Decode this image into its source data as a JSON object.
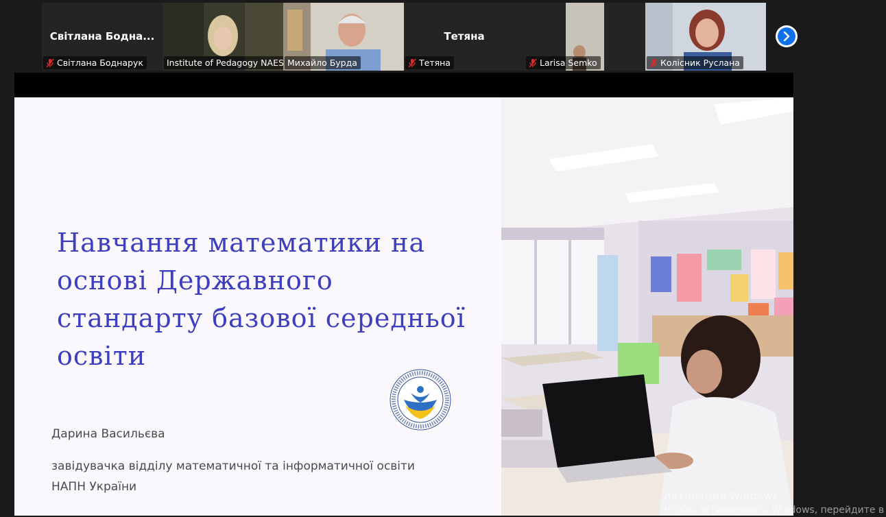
{
  "participants": [
    {
      "display": "Світлана  Бодна...",
      "label": "Світлана Боднарук",
      "muted": true,
      "video": false
    },
    {
      "display": "",
      "label": "Institute of Pedagogy NAES...",
      "muted": false,
      "video": true,
      "active": true
    },
    {
      "display": "",
      "label": "Михайло Бурда",
      "muted": false,
      "video": true
    },
    {
      "display": "Тетяна",
      "label": "Тетяна",
      "muted": true,
      "video": false
    },
    {
      "display": "",
      "label": "Larisa Semko",
      "muted": true,
      "video": true
    },
    {
      "display": "",
      "label": "Колісник Руслана",
      "muted": true,
      "video": true
    }
  ],
  "slide": {
    "title": "Навчання математики на основі Державного стандарту базової середньої освіти",
    "author": "Дарина Васильєва",
    "position": "завідувачка відділу математичної та інформатичної освіти НАПН України",
    "logo_ring_text": "INSTITUTE OF PEDAGOGY OF THE NAES OF UKRAINE · ІНСТИТУТ ПЕДАГОГІКИ НАПН УКРАЇНИ",
    "title_color": "#3d3fbf"
  },
  "watermark": {
    "line1": "Активация Windows",
    "line2": "Чтобы активировать Windows, перейдите в ра"
  },
  "colors": {
    "active_border": "#2fd38a",
    "next_button": "#0e71eb",
    "muted_mic": "#e02828"
  }
}
